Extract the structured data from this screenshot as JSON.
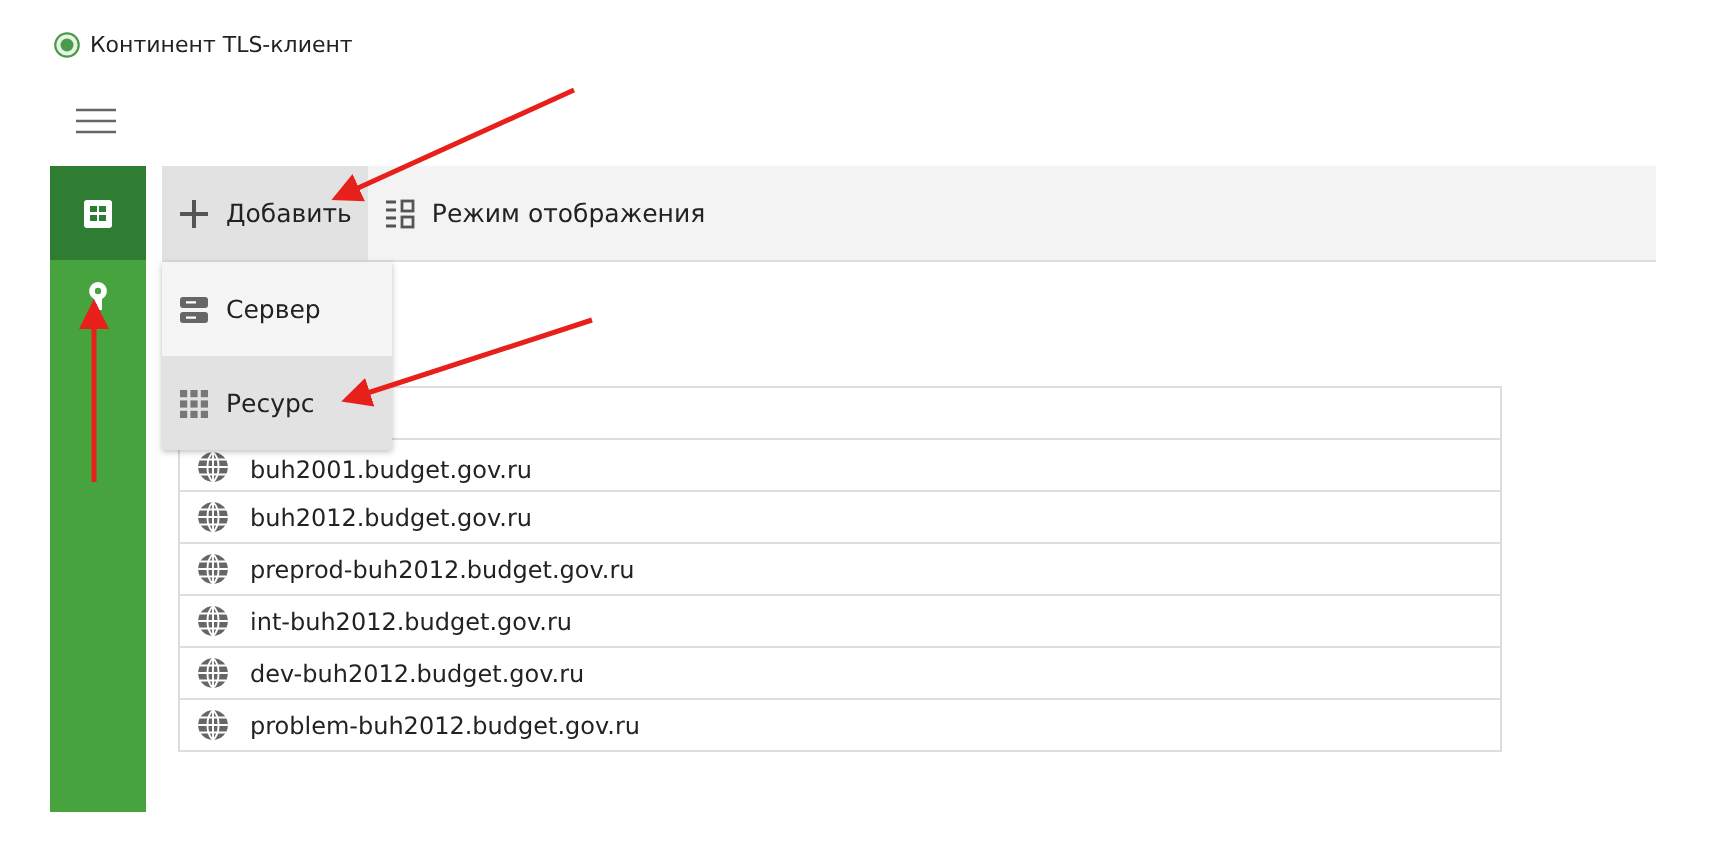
{
  "window": {
    "title": "Континент TLS-клиент"
  },
  "sidebar": {
    "items": [
      {
        "selected": true
      },
      {
        "selected": false
      }
    ]
  },
  "toolbar": {
    "buttons": [
      {
        "label": "Добавить",
        "selected": true
      },
      {
        "label": "Режим отображения",
        "selected": false
      }
    ]
  },
  "add_menu": {
    "items": [
      {
        "label": "Сервер",
        "selected": false
      },
      {
        "label": "Ресурс",
        "selected": true
      }
    ]
  },
  "resources": [
    {
      "name": "buh2001.budget.gov.ru"
    },
    {
      "name": "buh2012.budget.gov.ru"
    },
    {
      "name": "preprod-buh2012.budget.gov.ru"
    },
    {
      "name": "int-buh2012.budget.gov.ru"
    },
    {
      "name": "dev-buh2012.budget.gov.ru"
    },
    {
      "name": "problem-buh2012.budget.gov.ru"
    }
  ]
}
